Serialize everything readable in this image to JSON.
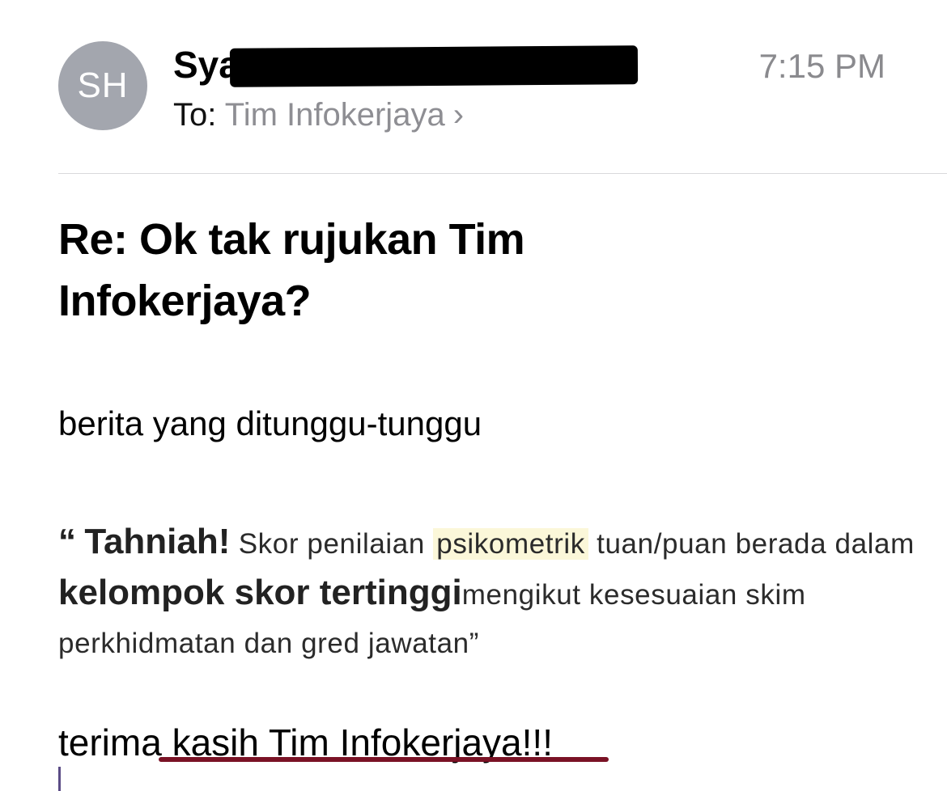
{
  "header": {
    "avatar_initials": "SH",
    "sender_name_visible": "Sya",
    "time": "7:15 PM",
    "to_label": "To:",
    "recipient": "Tim Infokerjaya",
    "chevron": "›"
  },
  "subject": "Re: Ok tak rujukan Tim Infokerjaya?",
  "body": {
    "line1": "berita yang ditunggu-tunggu",
    "quote": {
      "open_mark": "“",
      "tahniah": "Tahniah!",
      "part1": " Skor penilaian ",
      "highlight": "psikometrik",
      "part2": " tuan/puan berada dalam ",
      "bold_phrase": "kelompok skor tertinggi",
      "part3": "mengikut kesesuaian skim perkhidmatan dan gred jawatan",
      "close_mark": "”"
    },
    "closing": "terima kasih Tim Infokerjaya!!!"
  },
  "colors": {
    "avatar_bg": "#a3a6ae",
    "secondary_text": "#8e8e93",
    "highlight_bg": "#fbf7d9",
    "annotation_underline": "#7a1225"
  },
  "icons": {
    "chevron": "chevron-right-icon",
    "redaction": "redaction-mark"
  }
}
